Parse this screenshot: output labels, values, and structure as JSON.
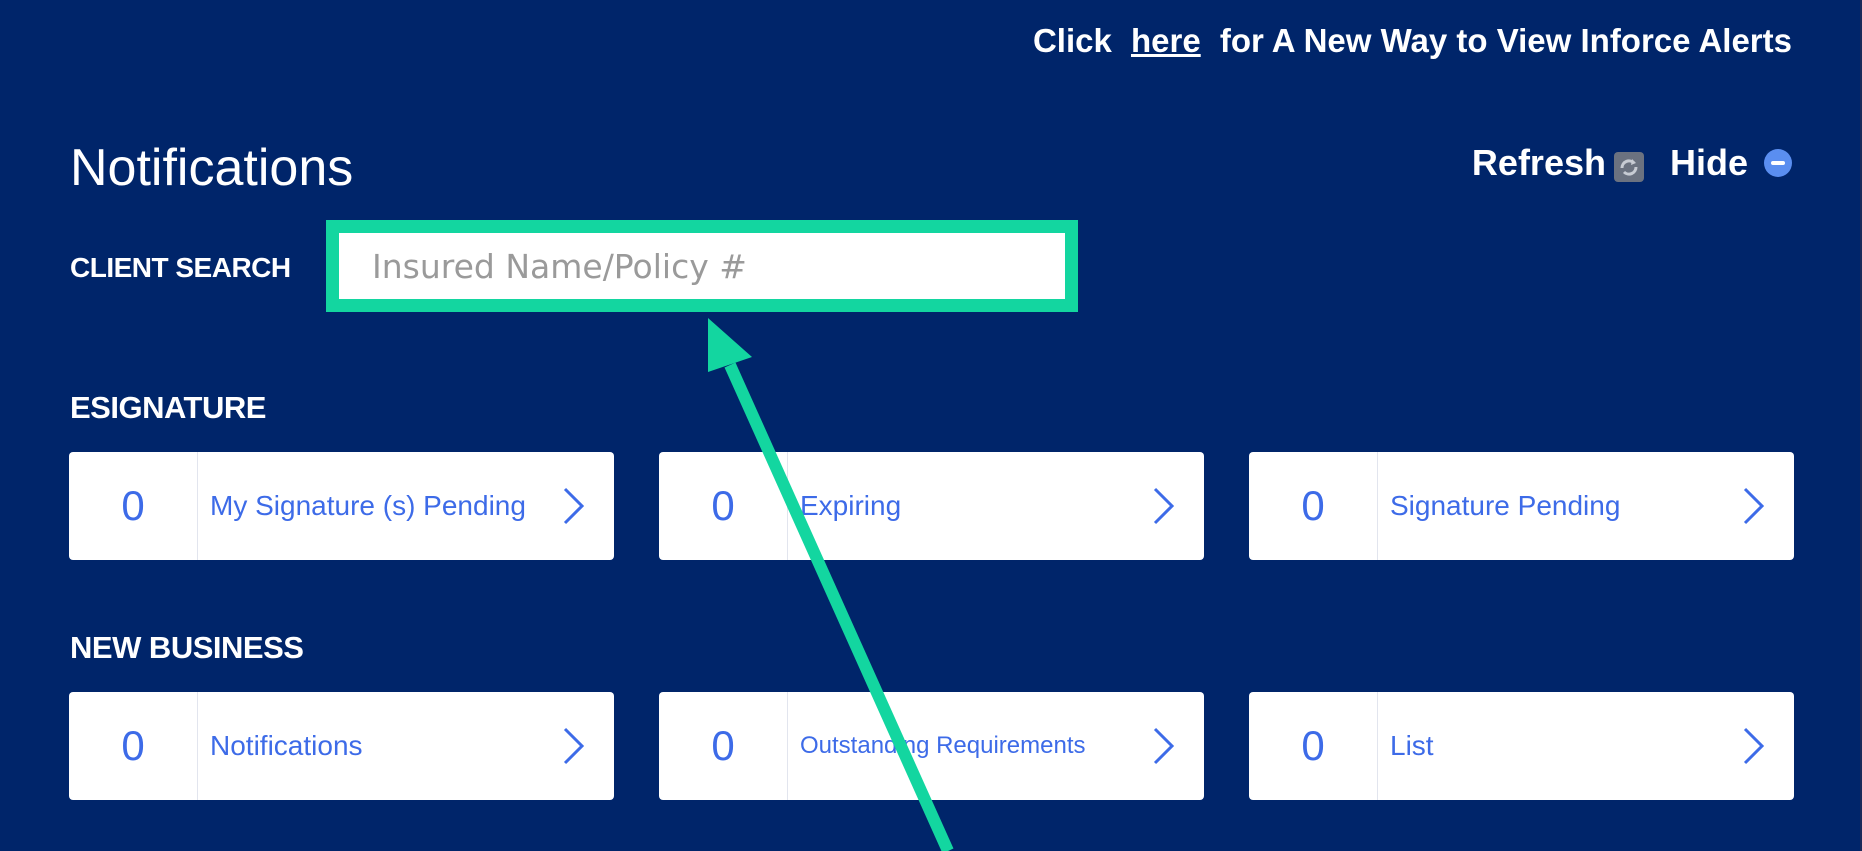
{
  "top_banner": {
    "prefix": "Click",
    "link": "here",
    "suffix": "for A New Way to View Inforce Alerts"
  },
  "header": {
    "title": "Notifications",
    "refresh_label": "Refresh",
    "hide_label": "Hide"
  },
  "client_search": {
    "label": "CLIENT SEARCH",
    "placeholder": "Insured Name/Policy #",
    "value": ""
  },
  "esignature": {
    "title": "ESIGNATURE",
    "cards": [
      {
        "count": "0",
        "label": "My Signature (s) Pending"
      },
      {
        "count": "0",
        "label": "Expiring"
      },
      {
        "count": "0",
        "label": "Signature Pending"
      }
    ]
  },
  "new_business": {
    "title": "NEW BUSINESS",
    "cards": [
      {
        "count": "0",
        "label": "Notifications"
      },
      {
        "count": "0",
        "label": "Outstanding Requirements"
      },
      {
        "count": "0",
        "label": "List"
      }
    ]
  },
  "colors": {
    "panel_background": "#00256a",
    "highlight": "#13d6a0",
    "link_blue": "#3d6be8",
    "hide_icon": "#5a8ef0"
  },
  "icons": [
    "refresh-icon",
    "hide-minus-icon",
    "chevron-right-icon",
    "annotation-arrow"
  ]
}
